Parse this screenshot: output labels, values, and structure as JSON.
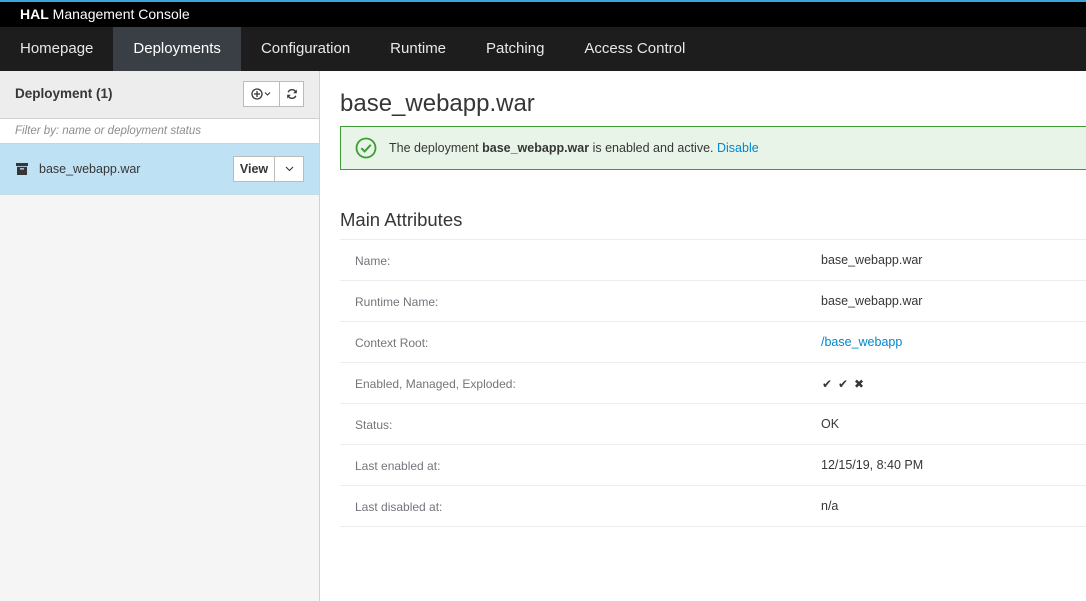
{
  "brand": {
    "prefix": "HAL",
    "suffix": " Management Console"
  },
  "nav": [
    {
      "label": "Homepage",
      "active": false
    },
    {
      "label": "Deployments",
      "active": true
    },
    {
      "label": "Configuration",
      "active": false
    },
    {
      "label": "Runtime",
      "active": false
    },
    {
      "label": "Patching",
      "active": false
    },
    {
      "label": "Access Control",
      "active": false
    }
  ],
  "sidebar": {
    "title": "Deployment (1)",
    "filter_placeholder": "Filter by: name or deployment status",
    "items": [
      {
        "label": "base_webapp.war",
        "view_label": "View"
      }
    ]
  },
  "main": {
    "title": "base_webapp.war",
    "alert": {
      "prefix": "The deployment ",
      "name": "base_webapp.war",
      "suffix": " is enabled and active. ",
      "action": "Disable",
      "color": "#3f9c35"
    },
    "section_title": "Main Attributes",
    "attributes": [
      {
        "label": "Name:",
        "value": "base_webapp.war"
      },
      {
        "label": "Runtime Name:",
        "value": "base_webapp.war"
      },
      {
        "label": "Context Root:",
        "value": "/base_webapp"
      },
      {
        "label": "Enabled, Managed, Exploded:",
        "flags": [
          "✔",
          "✔",
          "✖"
        ]
      },
      {
        "label": "Status:",
        "value": "OK"
      },
      {
        "label": "Last enabled at:",
        "value": "12/15/19, 8:40 PM"
      },
      {
        "label": "Last disabled at:",
        "value": "n/a"
      }
    ]
  }
}
